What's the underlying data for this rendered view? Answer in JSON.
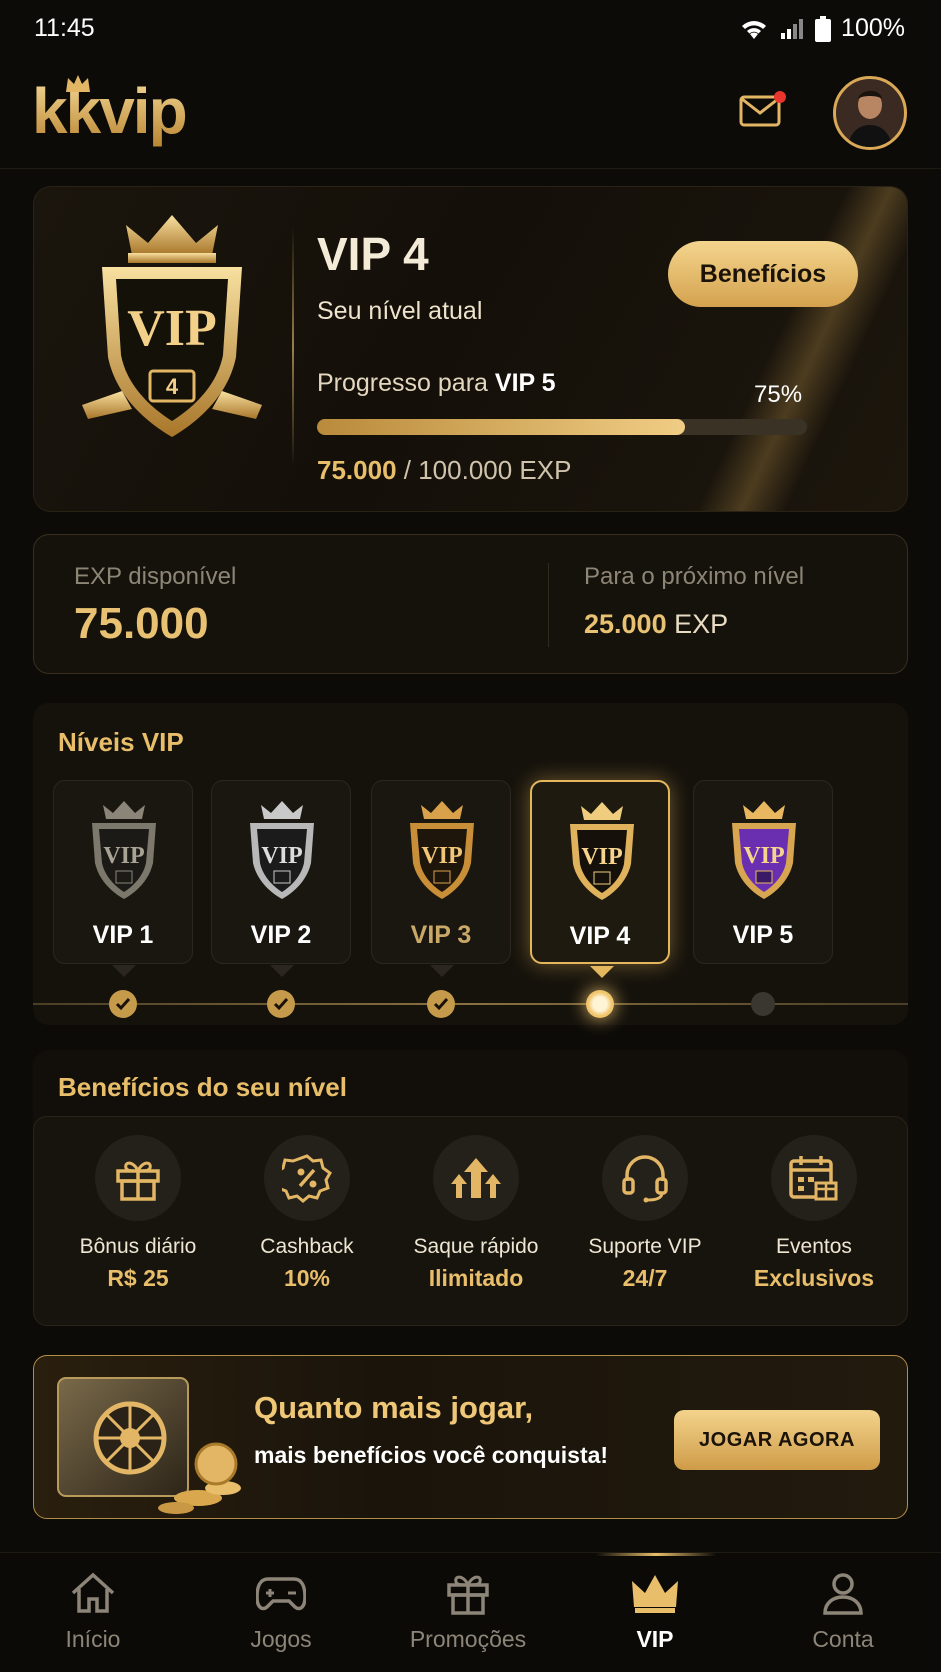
{
  "status_bar": {
    "time": "11:45",
    "battery": "100%"
  },
  "header": {
    "logo": "kkvip"
  },
  "hero": {
    "level": "VIP 4",
    "subtitle": "Seu nível atual",
    "benefits_button": "Benefícios",
    "progress_prefix": "Progresso para",
    "progress_target": "VIP 5",
    "progress_percent_label": "75%",
    "progress_fraction": 0.75,
    "exp_current": "75.000",
    "exp_total": "/ 100.000 EXP",
    "shield_text": "VIP",
    "shield_number": "4"
  },
  "exp_card": {
    "available_label": "EXP disponível",
    "available_value": "75.000",
    "next_label": "Para o próximo nível",
    "next_value": "25.000",
    "next_unit": "EXP"
  },
  "levels": {
    "title": "Níveis VIP",
    "items": [
      {
        "label": "VIP 1",
        "state": "done"
      },
      {
        "label": "VIP 2",
        "state": "done"
      },
      {
        "label": "VIP 3",
        "state": "done"
      },
      {
        "label": "VIP 4",
        "state": "current"
      },
      {
        "label": "VIP 5",
        "state": "locked"
      }
    ]
  },
  "benefits": {
    "title": "Benefícios do seu nível",
    "items": [
      {
        "icon": "gift-icon",
        "label": "Bônus diário",
        "value": "R$ 25"
      },
      {
        "icon": "percent-badge-icon",
        "label": "Cashback",
        "value": "10%"
      },
      {
        "icon": "arrows-up-icon",
        "label": "Saque rápido",
        "value": "Ilimitado"
      },
      {
        "icon": "headset-icon",
        "label": "Suporte VIP",
        "value": "24/7"
      },
      {
        "icon": "calendar-gift-icon",
        "label": "Eventos",
        "value": "Exclusivos"
      }
    ]
  },
  "promo": {
    "line1": "Quanto mais jogar,",
    "line2": "mais benefícios você conquista!",
    "button": "JOGAR AGORA"
  },
  "nav": {
    "items": [
      {
        "icon": "home-icon",
        "label": "Início"
      },
      {
        "icon": "gamepad-icon",
        "label": "Jogos"
      },
      {
        "icon": "gift-icon",
        "label": "Promoções"
      },
      {
        "icon": "crown-icon",
        "label": "VIP"
      },
      {
        "icon": "user-icon",
        "label": "Conta"
      }
    ],
    "active": "VIP"
  },
  "colors": {
    "accent": "#e8be6a",
    "background": "#0d0b08",
    "badge_vip5": "#6a2fb0"
  }
}
